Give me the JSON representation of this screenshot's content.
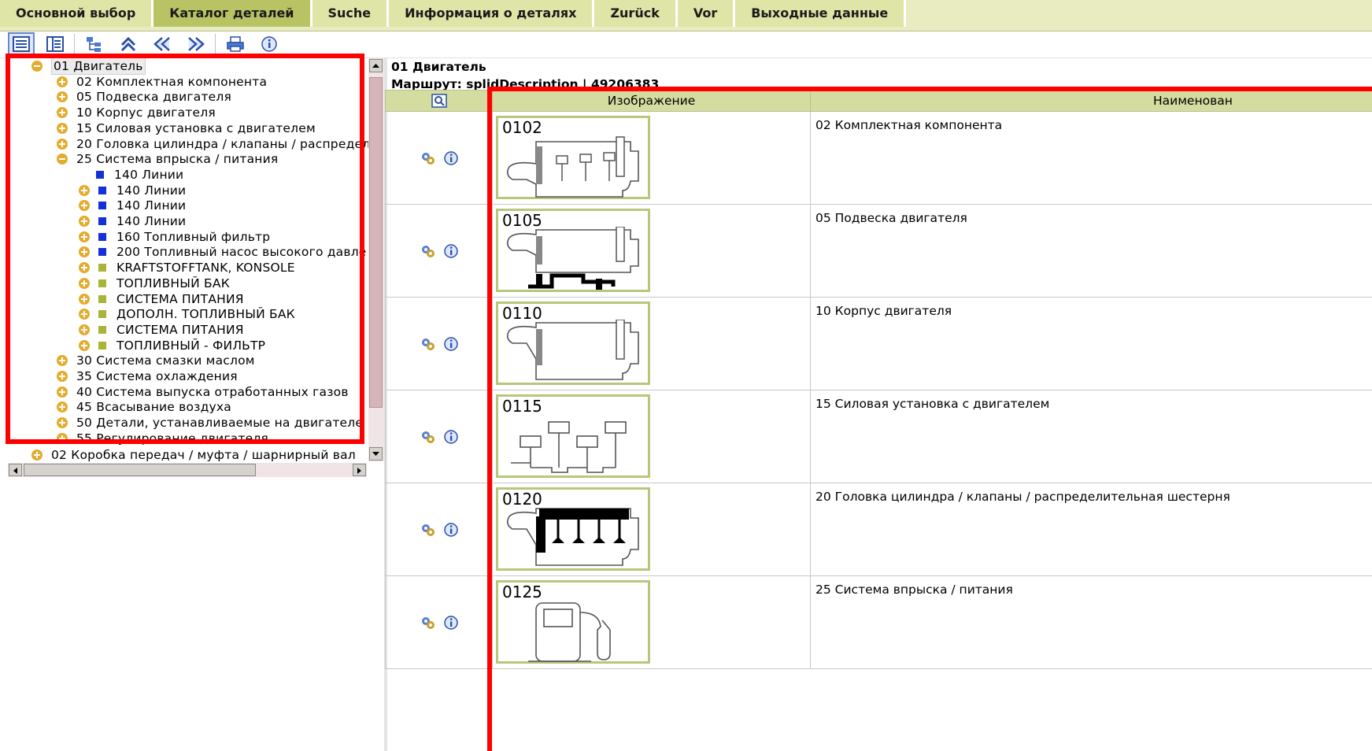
{
  "menu": {
    "items": [
      {
        "label": "Основной выбор",
        "active": false
      },
      {
        "label": "Каталог деталей",
        "active": true
      },
      {
        "label": "Suche",
        "active": false
      },
      {
        "label": "Информация о деталях",
        "active": false
      },
      {
        "label": "Zurück",
        "active": false
      },
      {
        "label": "Vor",
        "active": false
      },
      {
        "label": "Выходные данные",
        "active": false
      }
    ]
  },
  "toolbar": {
    "icons": [
      "tree-view-icon",
      "list-view-icon",
      "structure-icon",
      "collapse-up-icon",
      "previous-icon",
      "next-icon",
      "print-icon",
      "info-icon"
    ]
  },
  "tree": {
    "root_label": "01 Двигатель",
    "items": [
      {
        "label": "02 Комплектная компонента",
        "marker": "plus"
      },
      {
        "label": "05 Подвеска двигателя",
        "marker": "plus"
      },
      {
        "label": "10 Корпус двигателя",
        "marker": "plus"
      },
      {
        "label": "15 Силовая установка с двигателем",
        "marker": "plus"
      },
      {
        "label": "20 Головка цилиндра / клапаны / распредел",
        "marker": "plus"
      },
      {
        "label": "25 Система впрыска / питания",
        "marker": "minus"
      },
      {
        "label": "140 Линии",
        "marker": "blue"
      },
      {
        "label": "140 Линии",
        "marker": "plus-blue"
      },
      {
        "label": "140 Линии",
        "marker": "plus-blue"
      },
      {
        "label": "140 Линии",
        "marker": "plus-blue"
      },
      {
        "label": "160 Топливный фильтр",
        "marker": "plus-blue"
      },
      {
        "label": "200 Топливный насос высокого давле",
        "marker": "plus-blue"
      },
      {
        "label": "KRAFTSTOFFTANK, KONSOLE",
        "marker": "plus-olive"
      },
      {
        "label": "ТОПЛИВНЫЙ БАК",
        "marker": "plus-olive"
      },
      {
        "label": "СИСТЕМА ПИТАНИЯ",
        "marker": "plus-olive"
      },
      {
        "label": "ДОПОЛН. ТОПЛИВНЫЙ БАК",
        "marker": "plus-olive"
      },
      {
        "label": "СИСТЕМА ПИТАНИЯ",
        "marker": "plus-olive"
      },
      {
        "label": "ТОПЛИВНЫЙ - ФИЛЬТР",
        "marker": "plus-olive"
      },
      {
        "label": "30 Система смазки маслом",
        "marker": "plus"
      },
      {
        "label": "35 Система охлаждения",
        "marker": "plus"
      },
      {
        "label": "40 Система выпуска отработанных газов",
        "marker": "plus"
      },
      {
        "label": "45 Всасывание воздуха",
        "marker": "plus"
      },
      {
        "label": "50 Детали, устанавливаемые на двигателе",
        "marker": "plus"
      },
      {
        "label": "55 Регулирование двигателя",
        "marker": "plus"
      }
    ],
    "sibling_label": "02 Коробка передач / муфта / шарнирный вал"
  },
  "content": {
    "title": "01 Двигатель",
    "route": "Маршрут: splidDescription | 49206383",
    "columns": {
      "image": "Изображение",
      "name": "Наименован"
    },
    "rows": [
      {
        "code": "0102",
        "name": "02 Комплектная компонента",
        "pictogram": "engine-complete"
      },
      {
        "code": "0105",
        "name": "05 Подвеска двигателя",
        "pictogram": "engine-mount"
      },
      {
        "code": "0110",
        "name": "10 Корпус двигателя",
        "pictogram": "engine-block"
      },
      {
        "code": "0115",
        "name": "15 Силовая установка с двигателем",
        "pictogram": "pistons"
      },
      {
        "code": "0120",
        "name": "20 Головка цилиндра / клапаны / распределительная шестерня",
        "pictogram": "cylinder-head"
      },
      {
        "code": "0125",
        "name": "25 Система впрыска / питания",
        "pictogram": "fuel-pump"
      }
    ]
  },
  "colors": {
    "menu_bg": "#dfe4a7",
    "menu_active": "#b9c363",
    "header_bg": "#d5dca0",
    "highlight": "#ff0000",
    "tree_plus": "#e3ac2e"
  }
}
